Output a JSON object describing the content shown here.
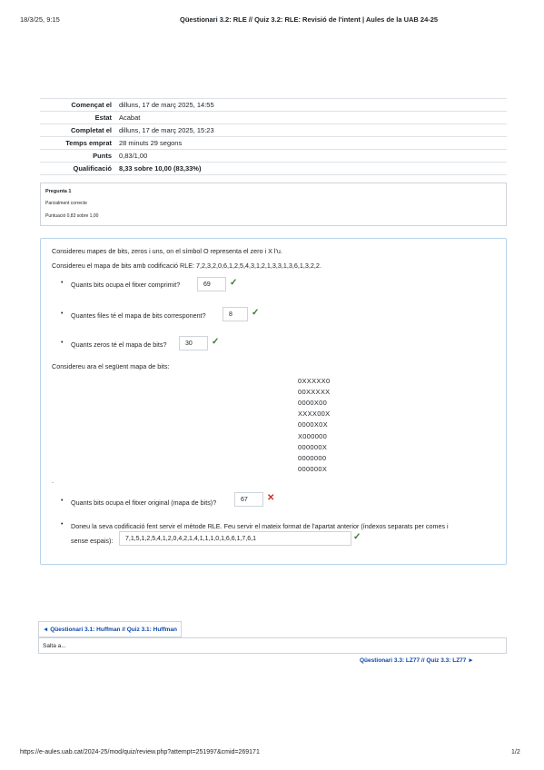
{
  "print_header": {
    "datetime": "18/3/25, 9:15",
    "title": "Qüestionari 3.2: RLE // Quiz 3.2: RLE: Revisió de l'intent | Aules de la UAB 24-25"
  },
  "summary": [
    {
      "label": "Començat el",
      "value": "dilluns, 17 de març 2025, 14:55"
    },
    {
      "label": "Estat",
      "value": "Acabat"
    },
    {
      "label": "Completat el",
      "value": "dilluns, 17 de març 2025, 15:23"
    },
    {
      "label": "Temps emprat",
      "value": "28 minuts 29 segons"
    },
    {
      "label": "Punts",
      "value": "0,83/1,00"
    },
    {
      "label": "Qualificació",
      "value": "8,33 sobre 10,00 (83,33%)"
    }
  ],
  "question_info": {
    "number_label": "Pregunta 1",
    "status": "Parcialment correcte",
    "mark": "Puntuació 0,83 sobre 1,00"
  },
  "question": {
    "intro": "Considereu mapes de bits, zeros i uns, on el símbol O representa el zero i X l'u.",
    "rle_intro": "Considereu el mapa de bits amb codificació RLE: 7,2,3,2,0,6,1,2,5,4,3,1,2,1,3,3,1,3,6,1,3,2,2.",
    "items1": [
      {
        "text": "Quants bits ocupa el fitxer comprimit?",
        "answer": "69",
        "result": "correct"
      },
      {
        "text": "Quantes files té el mapa de bits corresponent?",
        "answer": "8",
        "result": "correct"
      },
      {
        "text": "Quants zeros té el mapa de bits?",
        "answer": "30",
        "result": "correct"
      }
    ],
    "bitmap_intro": "Considereu ara el següent mapa de bits:",
    "bitmap_rows": [
      "0XXXXX0",
      "00XXXXX",
      "0000X00",
      "XXXX00X",
      "0000X0X",
      "X000000",
      "000000X",
      "0000000",
      "000000X"
    ],
    "dot": ".",
    "item4": {
      "text": "Quants bits ocupa el fitxer original (mapa de bits)?",
      "answer": "67",
      "result": "incorrect"
    },
    "item5": {
      "text_line1": "Doneu la seva codificació fent servir el mètode RLE. Feu servir el mateix format de l'apartat anterior (índexos separats per comes i",
      "text_line2": "sense espais):",
      "answer": "7,1,5,1,2,5,4,1,2,0,4,2,1,4,1,1,1,0,1,6,6,1,7,6,1",
      "result": "correct"
    }
  },
  "navigation": {
    "prev": "◄ Qüestionari 3.1: Huffman // Quiz 3.1: Huffman",
    "jump": "Salta a...",
    "next": "Qüestionari 3.3: LZ77 // Quiz 3.3: LZ77 ►"
  },
  "footer": {
    "url": "https://e-aules.uab.cat/2024-25/mod/quiz/review.php?attempt=251997&cmid=269171",
    "page": "1/2"
  },
  "colors": {
    "correct": "#357a32",
    "incorrect": "#ca3120",
    "link": "#0f47ad",
    "question_border": "#b7d3ea"
  }
}
